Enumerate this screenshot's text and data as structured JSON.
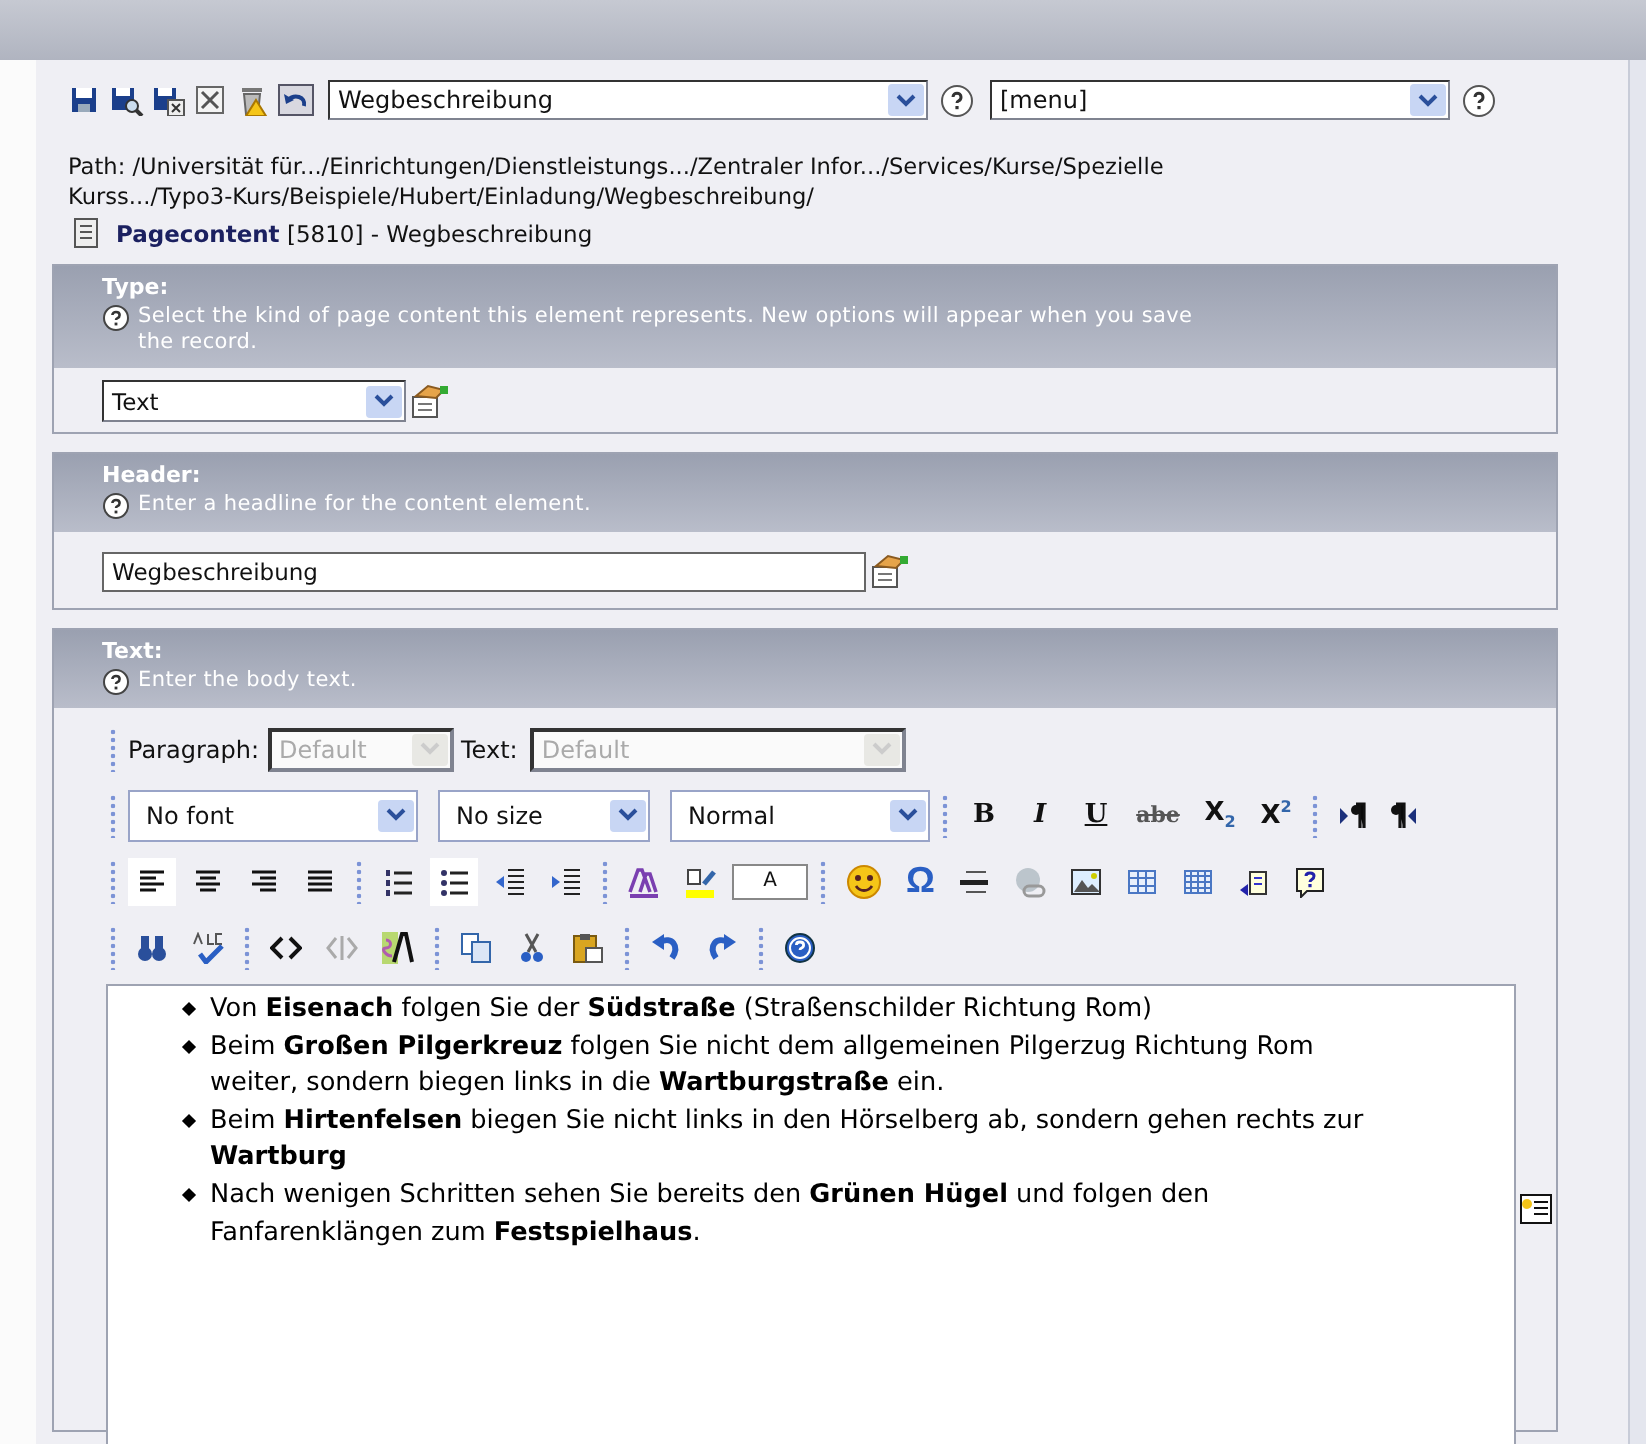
{
  "toolbar": {
    "page_select": {
      "value": "Wegbeschreibung"
    },
    "menu_select": {
      "value": "[menu]"
    }
  },
  "path": [
    "Path: /Universität für.../Einrichtungen/Dienstleistungs.../Zentraler Infor.../Services/Kurse/Spezielle",
    "Kurss.../Typo3-Kurs/Beispiele/Hubert/Einladung/Wegbeschreibung/"
  ],
  "record": "**Pagecontent** [5810] - Wegbeschreibung",
  "type_section": {
    "title": "Type:",
    "help": "Select the kind of page content this element represents. New options will appear when you save the record.",
    "value": "Text"
  },
  "header_section": {
    "title": "Header:",
    "help": "Enter a headline for the content element.",
    "value": "Wegbeschreibung"
  },
  "text_section": {
    "title": "Text:",
    "help": "Enter the body text.",
    "editor": {
      "paragraph_label": "Paragraph:",
      "paragraph_value": "Default",
      "text_label": "Text:",
      "text_value": "Default",
      "disabled": true,
      "font": "No font",
      "size": "No size",
      "format": "Normal",
      "format_buttons": [
        {
          "kind": "bold",
          "label": "B"
        },
        {
          "kind": "italic",
          "label": "I"
        },
        {
          "kind": "underline",
          "label": "U"
        },
        {
          "kind": "strike",
          "label": "abe"
        },
        {
          "kind": "sub",
          "label": "X$_{2}$"
        },
        {
          "kind": "sup",
          "label": "X$^{2}$"
        }
      ],
      "align": [
        {
          "selected": true
        },
        {
          "selected": false
        },
        {
          "selected": false
        },
        {
          "selected": false
        }
      ],
      "lists": [
        {
          "selected": false
        },
        {
          "selected": true
        }
      ],
      "color_sample": "A",
      "special_char": "Ω",
      "content": [
        "Von **Eisenach** folgen Sie der **Südstraße** (Straßenschilder Richtung Rom)",
        "Beim **Großen Pilgerkreuz** folgen Sie nicht dem allgemeinen Pilgerzug Richtung Rom weiter, sondern biegen links in die **Wartburgstraße** ein.",
        "Beim **Hirtenfelsen** biegen Sie nicht links in den Hörselberg ab, sondern gehen rechts zur **Wartburg**",
        "Nach wenigen Schritten sehen Sie bereits den **Grünen Hügel** und folgen den Fanfarenklängen zum **Festspielhaus**."
      ]
    }
  }
}
